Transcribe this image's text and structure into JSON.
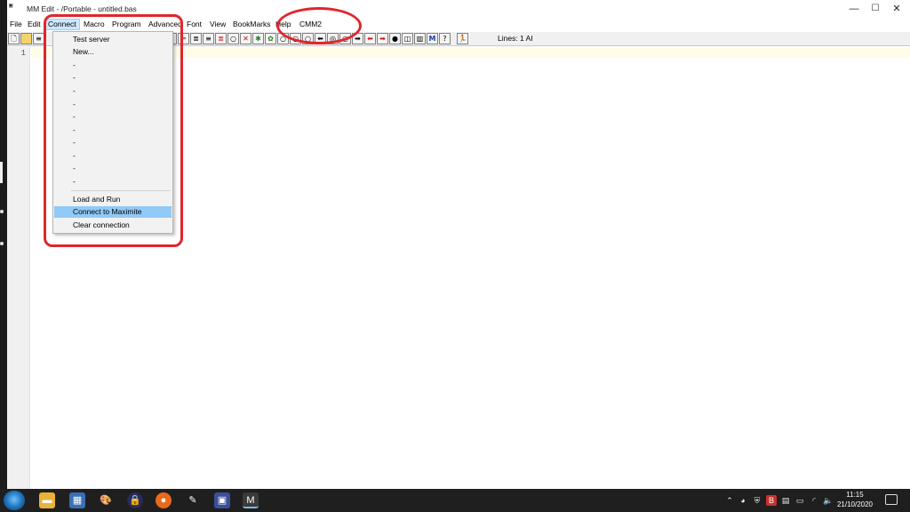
{
  "window": {
    "title": "MM Edit - /Portable - untitled.bas",
    "icon_text": "MM",
    "controls": [
      "—",
      "☐",
      "✕"
    ]
  },
  "menubar": [
    "File",
    "Edit",
    "Connect",
    "Macro",
    "Program",
    "Advanced",
    "Font",
    "View",
    "BookMarks",
    "Help",
    "CMM2"
  ],
  "connect_menu": {
    "items": [
      "Test server",
      "New...",
      "-",
      "-",
      "-",
      "-",
      "-",
      "-",
      "-",
      "-",
      "-",
      "-"
    ],
    "actions": [
      "Load and Run",
      "Connect to Maximite",
      "Clear connection"
    ],
    "highlighted": "Connect to Maximite"
  },
  "status": {
    "lines": "Lines: 1  AI"
  },
  "editor": {
    "line_number": "1"
  },
  "taskbar": {
    "time": "11:15",
    "date": "21/10/2020"
  }
}
